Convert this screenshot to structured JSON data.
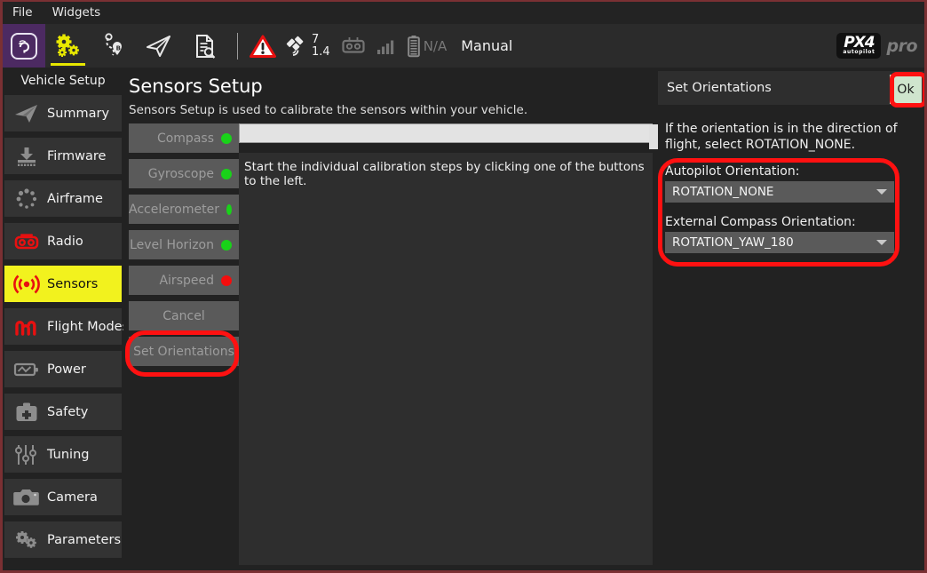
{
  "window": {
    "border_color": "#7a3033",
    "background": "#222222"
  },
  "menubar": {
    "items": [
      {
        "label": "File",
        "name": "menu-file"
      },
      {
        "label": "Widgets",
        "name": "menu-widgets"
      }
    ]
  },
  "toolbar": {
    "app_icon": "qgroundcontrol-logo-icon",
    "buttons": [
      {
        "icon": "gears-icon",
        "name": "toolbar-vehicle-setup",
        "active": true
      },
      {
        "icon": "plan-waypoints-icon",
        "name": "toolbar-plan",
        "active": false
      },
      {
        "icon": "fly-paper-plane-icon",
        "name": "toolbar-fly",
        "active": false
      },
      {
        "icon": "analyze-document-icon",
        "name": "toolbar-analyze",
        "active": false
      }
    ],
    "status": {
      "warning_icon": "warning-triangle-icon",
      "gps_icon": "satellite-icon",
      "gps_count": "7",
      "gps_hdop": "1.4",
      "rc_icon": "rc-transmitter-icon",
      "telemetry_icon": "signal-bars-icon",
      "battery_icon": "battery-icon",
      "battery_value": "N/A",
      "flight_mode": "Manual"
    },
    "brand": {
      "main": "PX4",
      "sub": "autopilot",
      "pro": "pro"
    }
  },
  "sidebar": {
    "title": "Vehicle Setup",
    "items": [
      {
        "label": "Summary",
        "icon": "paper-plane-icon",
        "selected": false,
        "name": "sidebar-item-summary"
      },
      {
        "label": "Firmware",
        "icon": "download-icon",
        "selected": false,
        "name": "sidebar-item-firmware"
      },
      {
        "label": "Airframe",
        "icon": "airframe-icon",
        "selected": false,
        "name": "sidebar-item-airframe"
      },
      {
        "label": "Radio",
        "icon": "radio-icon",
        "selected": false,
        "name": "sidebar-item-radio"
      },
      {
        "label": "Sensors",
        "icon": "sensors-icon",
        "selected": true,
        "name": "sidebar-item-sensors"
      },
      {
        "label": "Flight Modes",
        "icon": "flight-modes-icon",
        "selected": false,
        "name": "sidebar-item-flight-modes"
      },
      {
        "label": "Power",
        "icon": "power-battery-icon",
        "selected": false,
        "name": "sidebar-item-power"
      },
      {
        "label": "Safety",
        "icon": "safety-kit-icon",
        "selected": false,
        "name": "sidebar-item-safety"
      },
      {
        "label": "Tuning",
        "icon": "sliders-icon",
        "selected": false,
        "name": "sidebar-item-tuning"
      },
      {
        "label": "Camera",
        "icon": "camera-icon",
        "selected": false,
        "name": "sidebar-item-camera"
      },
      {
        "label": "Parameters",
        "icon": "gears-icon",
        "selected": false,
        "name": "sidebar-item-parameters"
      }
    ],
    "selected_color": "#f2f21e"
  },
  "main": {
    "title": "Sensors Setup",
    "subtitle": "Sensors Setup is used to calibrate the sensors within your vehicle.",
    "calibration_buttons": [
      {
        "label": "Compass",
        "status": "green",
        "name": "compass-calibration-button"
      },
      {
        "label": "Gyroscope",
        "status": "green",
        "name": "gyroscope-calibration-button"
      },
      {
        "label": "Accelerometer",
        "status": "green",
        "name": "accelerometer-calibration-button"
      },
      {
        "label": "Level Horizon",
        "status": "green",
        "name": "level-horizon-calibration-button"
      },
      {
        "label": "Airspeed",
        "status": "red",
        "name": "airspeed-calibration-button"
      },
      {
        "label": "Cancel",
        "status": "none",
        "name": "cancel-button"
      },
      {
        "label": "Set Orientations",
        "status": "none",
        "name": "set-orientations-button"
      }
    ],
    "status_colors": {
      "green": "#19d219",
      "red": "#f40d0d"
    },
    "progress_value": 0,
    "status_text": "Start the individual calibration steps by clicking one of the buttons to the left."
  },
  "right_panel": {
    "header_title": "Set Orientations",
    "ok_label": "Ok",
    "ok_color": "#cfe5cd",
    "help_text": "If the orientation is in the direction of flight, select ROTATION_NONE.",
    "fields": [
      {
        "label": "Autopilot Orientation:",
        "value": "ROTATION_NONE",
        "name": "autopilot-orientation-select"
      },
      {
        "label": "External Compass Orientation:",
        "value": "ROTATION_YAW_180",
        "name": "external-compass-orientation-select"
      }
    ]
  },
  "annotations": {
    "color": "#ff1111",
    "regions": [
      {
        "name": "annotation-set-orientations-button"
      },
      {
        "name": "annotation-ok-button"
      },
      {
        "name": "annotation-orientation-fields"
      }
    ]
  }
}
